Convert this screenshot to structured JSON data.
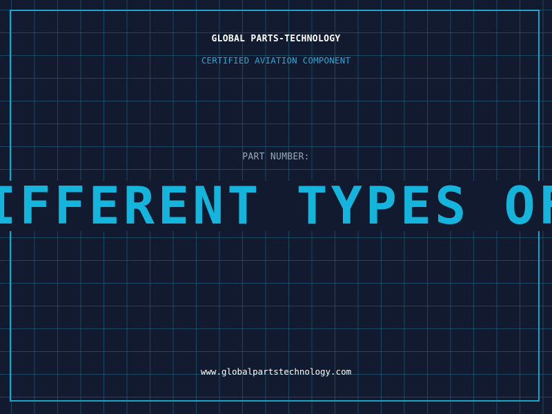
{
  "header": {
    "company": "GLOBAL PARTS-TECHNOLOGY",
    "subtitle": "CERTIFIED AVIATION COMPONENT"
  },
  "part": {
    "label": "PART NUMBER:",
    "value": "DIFFERENT TYPES OF AIRPLANE"
  },
  "footer": {
    "url": "www.globalpartstechnology.com"
  },
  "colors": {
    "background": "#111a2e",
    "grid": "#1e6e8c",
    "frame": "#1fa3c9",
    "accent": "#14b4dc"
  }
}
